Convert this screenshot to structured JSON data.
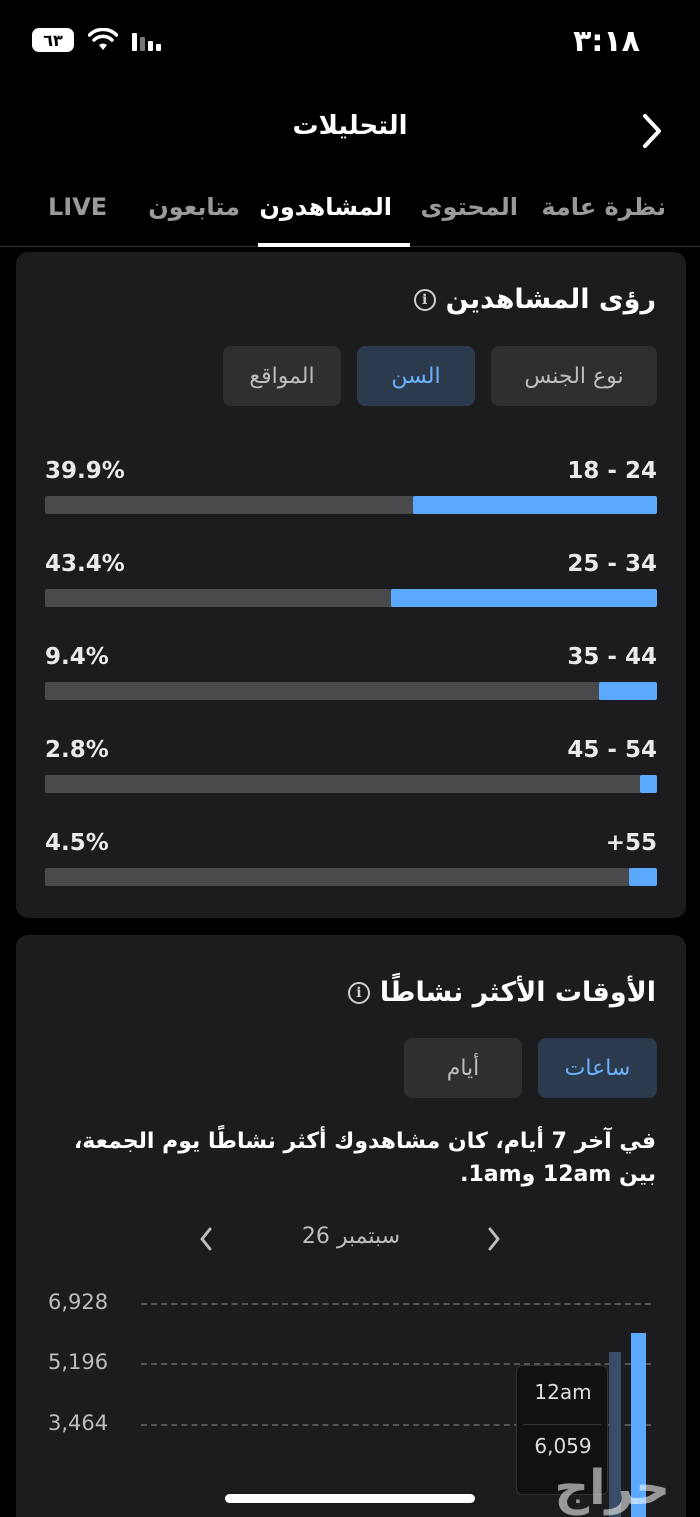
{
  "status": {
    "time": "٣:١٨",
    "battery": "٦٣"
  },
  "header": {
    "title": "التحليلات"
  },
  "tabs": [
    {
      "label": "نظرة عامة"
    },
    {
      "label": "المحتوى"
    },
    {
      "label": "المشاهدون"
    },
    {
      "label": "متابعون"
    },
    {
      "label": "LIVE"
    }
  ],
  "viewers_insights": {
    "title": "رؤى المشاهدين",
    "segments": [
      "نوع الجنس",
      "السن",
      "المواقع"
    ],
    "age_groups": [
      {
        "range": "18 - 24",
        "percent": "39.9%",
        "value": 39.9
      },
      {
        "range": "25 - 34",
        "percent": "43.4%",
        "value": 43.4
      },
      {
        "range": "35 - 44",
        "percent": "9.4%",
        "value": 9.4
      },
      {
        "range": "45 - 54",
        "percent": "2.8%",
        "value": 2.8
      },
      {
        "range": "+55",
        "percent": "4.5%",
        "value": 4.5
      }
    ]
  },
  "active_times": {
    "title": "الأوقات الأكثر نشاطًا",
    "segments": [
      "ساعات",
      "أيام"
    ],
    "summary": "في آخر 7 أيام، كان مشاهدوك أكثر نشاطًا يوم الجمعة، بين 12am و1am.",
    "date": "26 سبتمبر",
    "y_ticks": [
      "6,928",
      "5,196",
      "3,464"
    ],
    "tooltip": {
      "time": "12am",
      "value": "6,059"
    }
  },
  "chart_data": {
    "type": "bar",
    "categories": [
      "12am"
    ],
    "values": [
      6059
    ],
    "y_tick_values": [
      6928,
      5196,
      3464
    ]
  },
  "watermark": "حراج",
  "colors": {
    "accent": "#5aa9ff",
    "card": "#1c1c1e",
    "track": "#4a4a4c"
  }
}
